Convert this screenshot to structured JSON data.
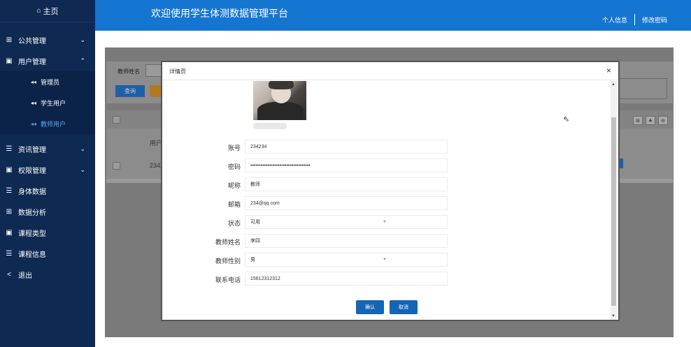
{
  "sidebar": {
    "home": "主页",
    "items": [
      {
        "label": "公共管理",
        "icon": "grid-icon",
        "chevron": "⌄"
      },
      {
        "label": "用户管理",
        "icon": "doc-icon",
        "chevron": "⌃"
      },
      {
        "label": "资讯管理",
        "icon": "list-icon",
        "chevron": "⌄"
      },
      {
        "label": "权限管理",
        "icon": "doc-icon",
        "chevron": "⌄"
      },
      {
        "label": "身体数据",
        "icon": "list-icon"
      },
      {
        "label": "数据分析",
        "icon": "grid-icon"
      },
      {
        "label": "课程类型",
        "icon": "doc-icon"
      },
      {
        "label": "课程信息",
        "icon": "list-icon"
      },
      {
        "label": "退出",
        "icon": "share-icon"
      }
    ],
    "subitems": [
      "管理员",
      "学生用户",
      "教师用户"
    ]
  },
  "header": {
    "title": "欢迎使用学生体测数据管理平台",
    "profile_link": "个人信息",
    "password_link": "修改密码"
  },
  "background": {
    "search_label": "教师姓名",
    "query_button": "查询",
    "col_user": "用户",
    "row_user": "2342"
  },
  "modal": {
    "title": "详情页",
    "close": "×",
    "fields": [
      {
        "label": "账号",
        "value": "234234"
      },
      {
        "label": "密码",
        "value": "•••••••••••••••••••••••••••••••••••"
      },
      {
        "label": "昵称",
        "value": "教师"
      },
      {
        "label": "邮箱",
        "value": "234@qq.com"
      },
      {
        "label": "状态",
        "value": "可用",
        "select": true
      },
      {
        "label": "教师姓名",
        "value": "李四"
      },
      {
        "label": "教师性别",
        "value": "男",
        "select": true
      },
      {
        "label": "联系电话",
        "value": "15812312312"
      }
    ],
    "confirm_button": "确认",
    "cancel_button": "取消"
  },
  "colors": {
    "sidebar_bg": "#0f2a52",
    "header_bg": "#1576d2",
    "button_bg": "#1465b3"
  }
}
